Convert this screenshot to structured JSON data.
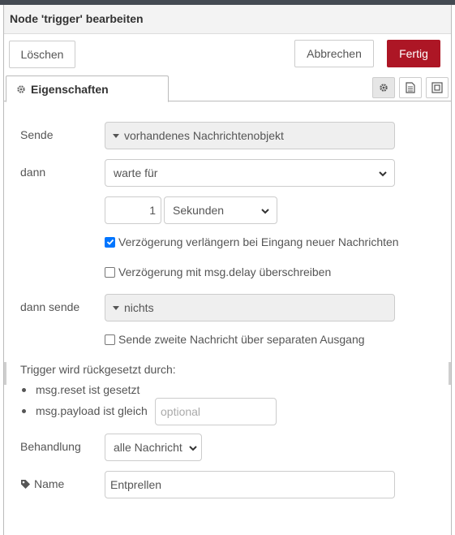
{
  "header": {
    "title": "Node 'trigger' bearbeiten"
  },
  "toolbar": {
    "delete_label": "Löschen",
    "cancel_label": "Abbrechen",
    "done_label": "Fertig"
  },
  "tabs": {
    "active_label": "Eigenschaften",
    "icon_buttons": [
      "gear-icon",
      "document-icon",
      "frame-icon"
    ]
  },
  "form": {
    "send_label": "Sende",
    "send_value": "vorhandenes Nachrichtenobjekt",
    "then_label": "dann",
    "then_value": "warte für",
    "delay_value": "1",
    "delay_unit": "Sekunden",
    "extend_label": "Verzögerung verlängern bei Eingang neuer Nachrichten",
    "extend_checked": true,
    "override_label": "Verzögerung mit msg.delay überschreiben",
    "override_checked": false,
    "then_send_label": "dann sende",
    "then_send_value": "nichts",
    "second_output_label": "Sende zweite Nachricht über separaten Ausgang",
    "second_output_checked": false,
    "reset_title": "Trigger wird rückgesetzt durch:",
    "reset_item1": "msg.reset ist gesetzt",
    "reset_item2": "msg.payload ist gleich",
    "reset_payload_placeholder": "optional",
    "handling_label": "Behandlung",
    "handling_value": "alle Nachricht",
    "name_label": "Name",
    "name_value": "Entprellen"
  },
  "colors": {
    "primary": "#ad1625",
    "checkbox": "#0075ff",
    "header_bg": "#f3f3f3",
    "typed_bg": "#efefef"
  }
}
